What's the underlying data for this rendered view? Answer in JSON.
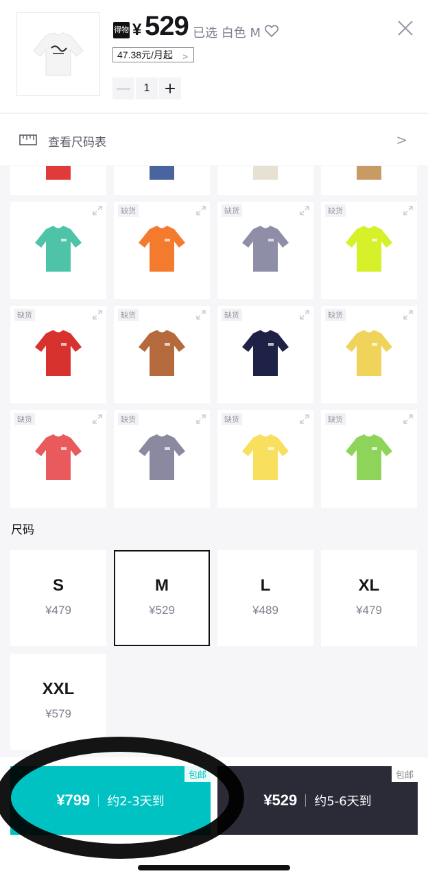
{
  "header": {
    "brand_badge": "得物",
    "currency": "¥",
    "price": "529",
    "selected": "已选 白色 M",
    "installment": "47.38元/月起",
    "quantity": "1",
    "minus": "—",
    "plus": "+"
  },
  "size_chart": {
    "label": "查看尺码表"
  },
  "colors": [
    {
      "color": "#e13a3b",
      "oos": "",
      "partial": true
    },
    {
      "color": "#4a64a0",
      "oos": "",
      "partial": true
    },
    {
      "color": "#e7e1d4",
      "oos": "",
      "partial": true
    },
    {
      "color": "#c99b64",
      "oos": "",
      "partial": true
    },
    {
      "color": "#4ec3a8",
      "oos": ""
    },
    {
      "color": "#f47a2e",
      "oos": "缺货"
    },
    {
      "color": "#8f8ea8",
      "oos": "缺货"
    },
    {
      "color": "#d6f02a",
      "oos": "缺货"
    },
    {
      "color": "#d8322e",
      "oos": "缺货"
    },
    {
      "color": "#b56a3d",
      "oos": "缺货"
    },
    {
      "color": "#1e2246",
      "oos": "缺货"
    },
    {
      "color": "#efd35a",
      "oos": "缺货"
    },
    {
      "color": "#e85a5c",
      "oos": "缺货"
    },
    {
      "color": "#8a89a0",
      "oos": "缺货"
    },
    {
      "color": "#f8e05e",
      "oos": "缺货"
    },
    {
      "color": "#8fd45a",
      "oos": "缺货"
    }
  ],
  "size_section": {
    "label": "尺码"
  },
  "sizes": [
    {
      "name": "S",
      "price": "¥479"
    },
    {
      "name": "M",
      "price": "¥529",
      "selected": true
    },
    {
      "name": "L",
      "price": "¥489"
    },
    {
      "name": "XL",
      "price": "¥479"
    },
    {
      "name": "XXL",
      "price": "¥579"
    }
  ],
  "buy": {
    "fast_price": "¥799",
    "fast_eta": "约2-3天到",
    "fast_free": "包邮",
    "normal_price": "¥529",
    "normal_eta": "约5-6天到",
    "normal_free": "包邮"
  },
  "accent": "#01c2c3"
}
